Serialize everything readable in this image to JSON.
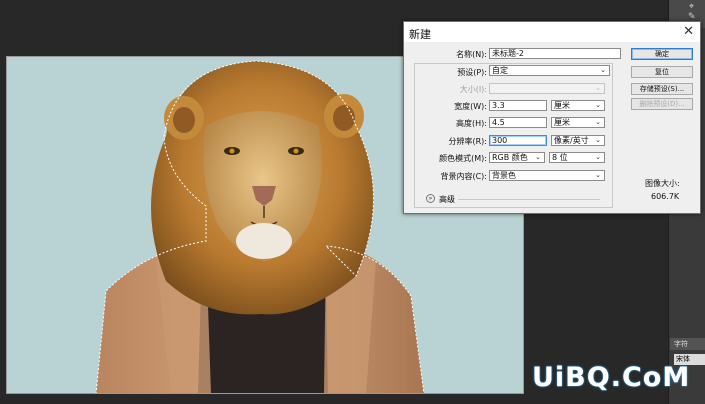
{
  "dialog": {
    "title": "新建",
    "close_glyph": "✕",
    "fields": {
      "name": {
        "label": "名称(N):",
        "value": "未标题-2"
      },
      "preset": {
        "label": "预设(P):",
        "value": "自定"
      },
      "size": {
        "label": "大小(I):",
        "value": ""
      },
      "width": {
        "label": "宽度(W):",
        "value": "3.3",
        "unit": "厘米"
      },
      "height": {
        "label": "高度(H):",
        "value": "4.5",
        "unit": "厘米"
      },
      "resolution": {
        "label": "分辨率(R):",
        "value": "300",
        "unit": "像素/英寸"
      },
      "color_mode": {
        "label": "颜色模式(M):",
        "value": "RGB 颜色",
        "depth": "8 位"
      },
      "background": {
        "label": "背景内容(C):",
        "value": "背景色"
      }
    },
    "advanced_label": "高级",
    "buttons": {
      "ok": "确定",
      "reset": "复位",
      "save_preset": "存储预设(S)...",
      "delete_preset": "删除预设(D)..."
    },
    "image_size_label": "图像大小:",
    "image_size_value": "606.7K"
  },
  "right_panel": {
    "tab_label": "字符",
    "font_field": "宋体"
  },
  "watermark": "UiBQ.CoM",
  "colors": {
    "canvas_bg": "#b9d2d3",
    "workspace_bg": "#282828",
    "focus_blue": "#3a8de0"
  }
}
